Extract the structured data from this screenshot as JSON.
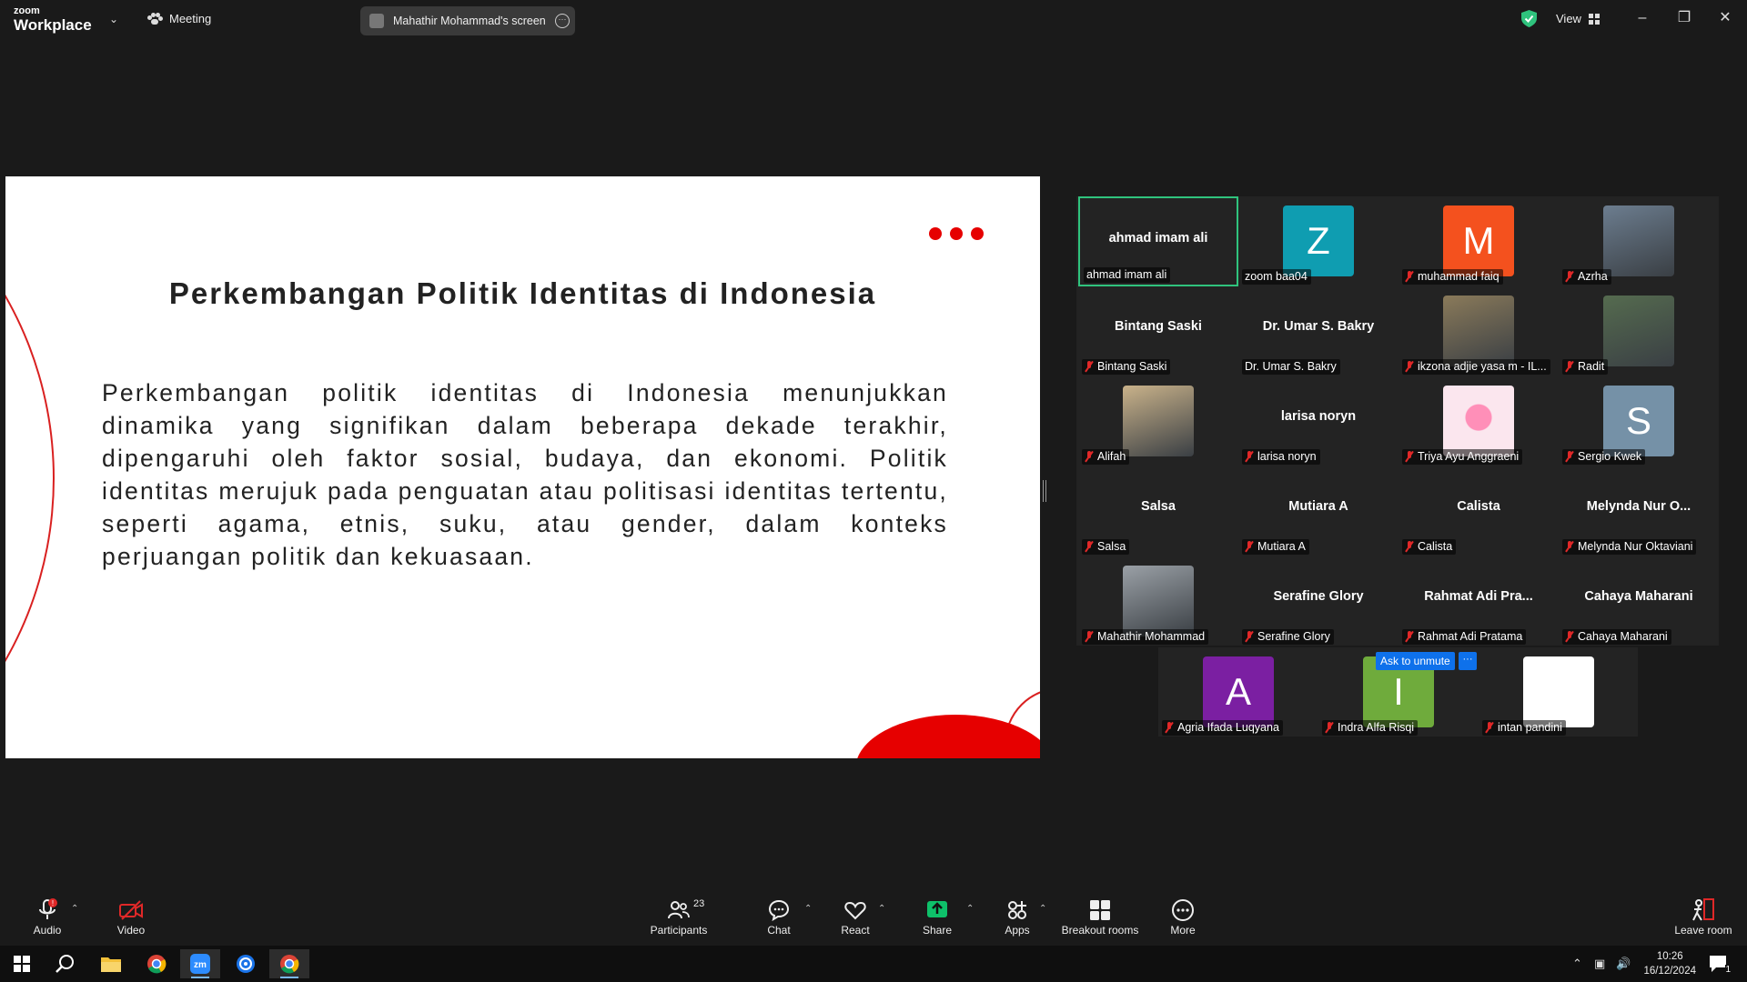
{
  "titlebar": {
    "logo_line1": "zoom",
    "logo_line2": "Workplace",
    "meeting_label": "Meeting",
    "screen_tab_label": "Mahathir Mohammad's screen",
    "view_label": "View",
    "security_color": "#2fc37d"
  },
  "slide": {
    "title": "Perkembangan Politik Identitas di Indonesia",
    "body": "Perkembangan politik identitas di Indonesia menunjukkan dinamika yang signifikan dalam beberapa dekade terakhir, dipengaruhi oleh faktor sosial, budaya, dan ekonomi. Politik identitas merujuk pada penguatan atau politisasi identitas tertentu, seperti agama, etnis, suku, atau gender, dalam konteks perjuangan politik dan kekuasaan.",
    "accent_color": "#e60000"
  },
  "participants": [
    {
      "label": "ahmad imam ali",
      "center_name": "ahmad imam ali",
      "muted": false,
      "active": true
    },
    {
      "label": "zoom baa04",
      "avatar_letter": "Z",
      "avatar_color": "#0f9db1",
      "muted": false
    },
    {
      "label": "muhammad faiq",
      "avatar_letter": "M",
      "avatar_color": "#f4511e",
      "muted": true
    },
    {
      "label": "Azrha",
      "photo": true,
      "muted": true
    },
    {
      "label": "Bintang Saski",
      "center_name": "Bintang Saski",
      "muted": true
    },
    {
      "label": "Dr. Umar S. Bakry",
      "center_name": "Dr. Umar S. Bakry",
      "muted": false
    },
    {
      "label": "ikzona adjie yasa m - IL...",
      "photo": true,
      "muted": true
    },
    {
      "label": "Radit",
      "photo": true,
      "muted": true
    },
    {
      "label": "Alifah",
      "photo": true,
      "muted": true
    },
    {
      "label": "larisa noryn",
      "center_name": "larisa noryn",
      "muted": true
    },
    {
      "label": "Triya Ayu Anggraeni",
      "photo": true,
      "muted": true
    },
    {
      "label": "Sergio Kwek",
      "avatar_letter": "S",
      "avatar_color": "#7591a7",
      "muted": true
    },
    {
      "label": "Salsa",
      "center_name": "Salsa",
      "muted": true
    },
    {
      "label": "Mutiara A",
      "center_name": "Mutiara A",
      "muted": true
    },
    {
      "label": "Calista",
      "center_name": "Calista",
      "muted": true
    },
    {
      "label": "Melynda Nur Oktaviani",
      "center_name": "Melynda Nur O...",
      "muted": true
    },
    {
      "label": "Mahathir Mohammad",
      "photo": true,
      "muted": true
    },
    {
      "label": "Serafine Glory",
      "center_name": "Serafine Glory",
      "muted": true
    },
    {
      "label": "Rahmat Adi Pratama",
      "center_name": "Rahmat Adi Pra...",
      "muted": true
    },
    {
      "label": "Cahaya Maharani",
      "center_name": "Cahaya Maharani",
      "muted": true
    },
    {
      "label": "Agria Ifada Luqyana",
      "avatar_letter": "A",
      "avatar_color": "#7b1fa2",
      "muted": true
    },
    {
      "label": "Indra Alfa Risqi",
      "avatar_letter": "I",
      "avatar_color": "#6fab3c",
      "muted": true
    },
    {
      "label": "intan pandini",
      "photo": true,
      "muted": true
    }
  ],
  "ask_to_unmute": "Ask to unmute",
  "ask_more": "···",
  "toolbar": {
    "audio": "Audio",
    "video": "Video",
    "participants": "Participants",
    "participants_count": "23",
    "chat": "Chat",
    "react": "React",
    "share": "Share",
    "apps": "Apps",
    "breakout": "Breakout rooms",
    "more": "More",
    "leave": "Leave room",
    "share_color": "#0ec16a"
  },
  "taskbar": {
    "time": "10:26",
    "date": "16/12/2024",
    "notif_count": "1"
  }
}
